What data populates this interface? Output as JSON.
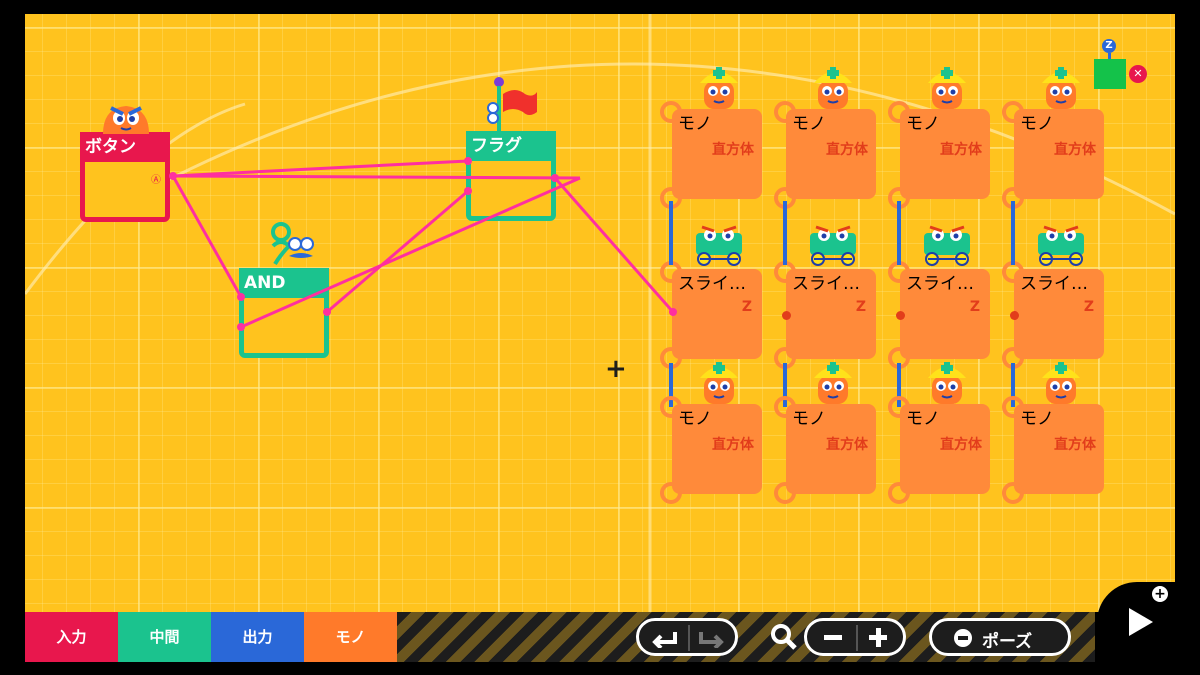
{
  "nodes": {
    "button": {
      "title": "ボタン",
      "input_label": "Ⓐ"
    },
    "and": {
      "title": "AND"
    },
    "flag": {
      "title": "フラグ"
    }
  },
  "objects": {
    "mono_title": "モノ",
    "mono_sub": "直方体",
    "slider_title": "スライ…",
    "slider_z": "Z"
  },
  "hud": {
    "top_right_badge": "Z"
  },
  "toolbar": {
    "tabs": [
      "入力",
      "中間",
      "出力",
      "モノ"
    ],
    "pause_label": "ポーズ"
  },
  "colors": {
    "background": "#ffc31e",
    "input": "#e8174d",
    "middle": "#1bc38e",
    "output": "#2a68d8",
    "object": "#ff7a2a",
    "link": "#ff2fa0"
  }
}
